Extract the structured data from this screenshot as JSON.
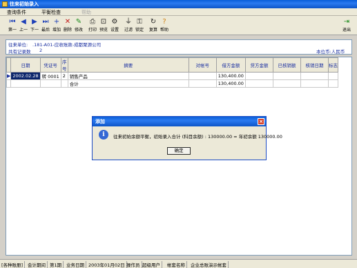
{
  "window": {
    "title": "往来初始录入"
  },
  "menu": {
    "items": [
      "查询条件",
      "平衡检查"
    ],
    "disabled_item": "帮助"
  },
  "toolbar": {
    "buttons": [
      {
        "label": "第一",
        "icon": "first-record-icon",
        "glyph": "⏮"
      },
      {
        "label": "上一",
        "icon": "previous-record-icon",
        "glyph": "◀"
      },
      {
        "label": "下一",
        "icon": "next-record-icon",
        "glyph": "▶"
      },
      {
        "label": "最后",
        "icon": "last-record-icon",
        "glyph": "⏭"
      },
      {
        "label": "增加",
        "icon": "add-icon",
        "glyph": "+"
      },
      {
        "label": "删除",
        "icon": "delete-icon",
        "glyph": "✕"
      },
      {
        "label": "修改",
        "icon": "edit-icon",
        "glyph": "✎"
      },
      {
        "label": "打印",
        "icon": "print-icon",
        "glyph": "⎙"
      },
      {
        "label": "预览",
        "icon": "preview-icon",
        "glyph": "⊡"
      },
      {
        "label": "设置",
        "icon": "settings-icon",
        "glyph": "⚙"
      },
      {
        "label": "过滤",
        "icon": "filter-icon",
        "glyph": "⏚"
      },
      {
        "label": "锁定",
        "icon": "lock-icon",
        "glyph": "⚿"
      },
      {
        "label": "复算",
        "icon": "recalculate-icon",
        "glyph": "↻"
      },
      {
        "label": "帮助",
        "icon": "help-icon",
        "glyph": "?"
      }
    ],
    "exit": {
      "label": "退出",
      "icon": "exit-icon",
      "glyph": "⇥"
    }
  },
  "info_panel": {
    "unit_label": "往来单位:",
    "unit_value": ".181-A01-应收账款-成都聚源公司",
    "count_label": "共有记录数",
    "count_value": "2",
    "currency": "本位币:人民币"
  },
  "grid": {
    "headers": [
      "日期",
      "凭证号",
      "序号",
      "摘要",
      "对帐号",
      "借方金额",
      "贷方金额",
      "已核销额",
      "核销日期",
      "标志"
    ],
    "rows": [
      [
        "2002.02.28",
        "转 0001",
        "2",
        "销售产品",
        "",
        "130,400.00",
        "",
        "",
        "",
        ""
      ],
      [
        "",
        "",
        "",
        "合计",
        "",
        "130,400.00",
        "",
        "",
        "",
        ""
      ]
    ]
  },
  "dialog": {
    "title": "添加",
    "message": "往来初始余额平衡，初始录入合计 (科目余额) : 130000.00 = 年初余额  130000.00",
    "ok_label": "确定"
  },
  "status_bar": [
    "[各种账册]",
    "会计期间",
    "第1期",
    "业务日期",
    "2003年01月02日",
    "操作员",
    "超级用户",
    "帐套名称",
    "企业总账演示帐套"
  ],
  "colors": {
    "accent": "#0a246a",
    "header_text": "#1a2fa0",
    "titlebar": "#0a5ed8"
  }
}
